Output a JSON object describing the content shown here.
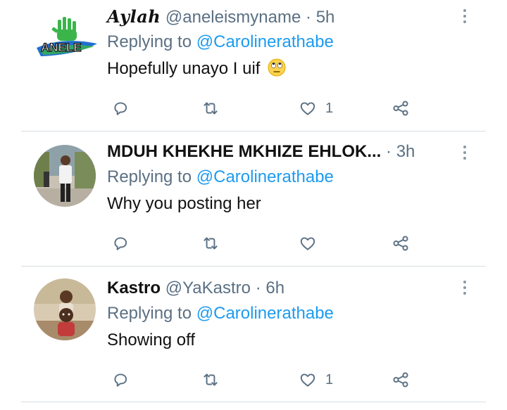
{
  "tweets": [
    {
      "name": "Aylah",
      "handle": "@aneleismyname",
      "dot": "·",
      "time": "5h",
      "replying_prefix": "Replying to",
      "replying_to": "@Carolinerathabe",
      "text": "Hopefully unayo I uif",
      "emoji": "eye-roll-emoji",
      "like_count": "1",
      "avatar": "anele-logo-avatar"
    },
    {
      "name": "MDUH KHEKHE MKHIZE EHLOK...",
      "handle": "",
      "dot": "·",
      "time": "3h",
      "replying_prefix": "Replying to",
      "replying_to": "@Carolinerathabe",
      "text": "Why you posting her",
      "like_count": "",
      "avatar": "man-standing-photo-avatar"
    },
    {
      "name": "Kastro",
      "handle": "@YaKastro",
      "dot": "·",
      "time": "6h",
      "replying_prefix": "Replying to",
      "replying_to": "@Carolinerathabe",
      "text": "Showing off",
      "like_count": "1",
      "avatar": "children-photo-avatar"
    }
  ],
  "logo_text": "ANELE",
  "icons": [
    "reply-icon",
    "retweet-icon",
    "like-icon",
    "share-icon",
    "more-options-icon"
  ],
  "colors": {
    "mention": "#1d9bf0",
    "secondary_text": "#5b7083",
    "divider": "#d8dde1"
  }
}
